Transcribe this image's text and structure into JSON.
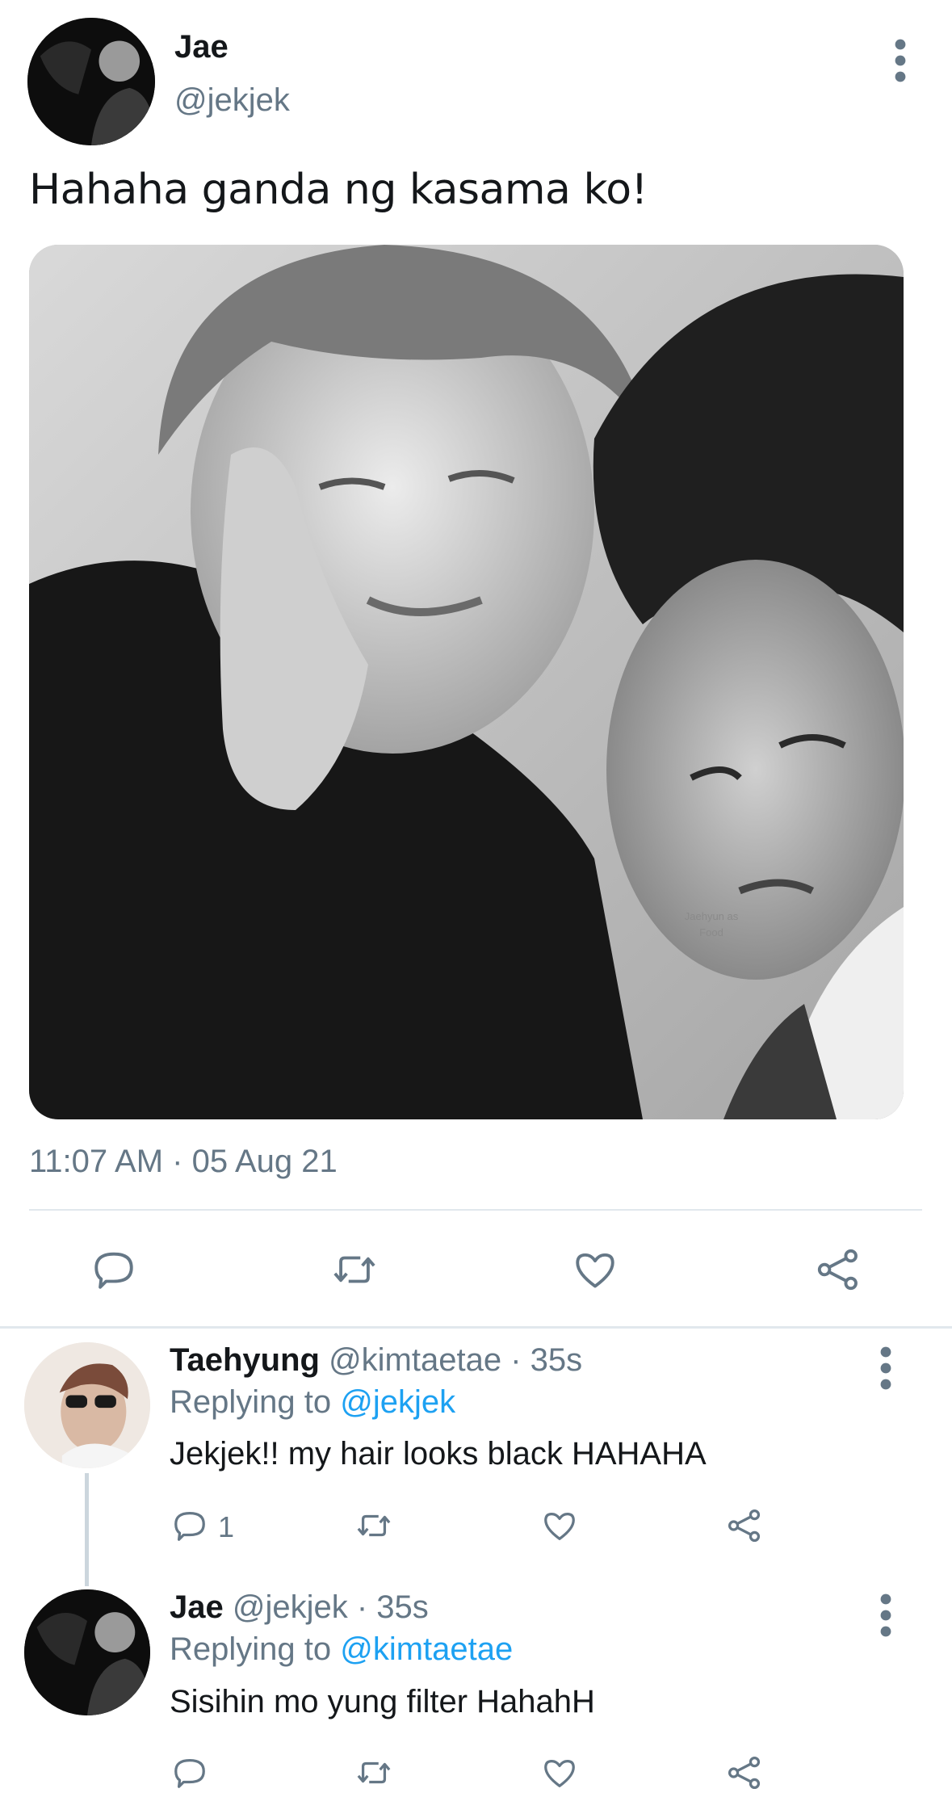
{
  "tweet": {
    "author_name": "Jae",
    "author_handle": "@jekjek",
    "text": "Hahaha ganda ng kasama ko!",
    "timestamp": "11:07 AM · 05 Aug 21",
    "photo_watermark": "Jaehyun as Food",
    "avatar_icon": "user-avatar-dark"
  },
  "replies": [
    {
      "name": "Taehyung",
      "handle": "@kimtaetae",
      "sep_time": " · 35s",
      "replying_label": "Replying to ",
      "replying_to": "@jekjek",
      "text": "Jekjek!! my hair looks black HAHAHA",
      "reply_count": "1"
    },
    {
      "name": "Jae",
      "handle": "@jekjek",
      "sep_time": " · 35s",
      "replying_label": "Replying to ",
      "replying_to": "@kimtaetae",
      "text": "Sisihin mo yung filter HahahH",
      "reply_count": ""
    }
  ],
  "colors": {
    "text": "#14171a",
    "muted": "#657786",
    "link": "#1da1f2",
    "icon": "#657786",
    "divider": "#e1e8ed"
  },
  "icons": [
    "more-vertical-icon",
    "reply-icon",
    "retweet-icon",
    "like-icon",
    "share-icon"
  ]
}
